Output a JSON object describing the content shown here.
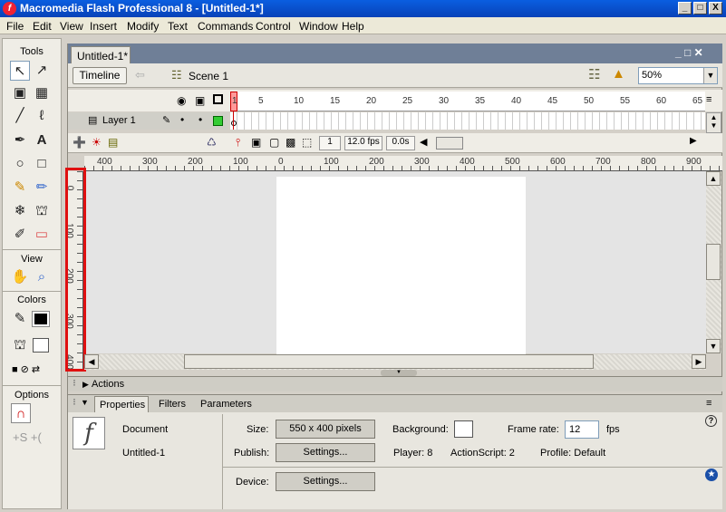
{
  "window": {
    "title": "Macromedia Flash Professional 8 - [Untitled-1*]",
    "logo": "f",
    "controls": [
      "_",
      "□",
      "X"
    ]
  },
  "menubar": {
    "items": [
      "File",
      "Edit",
      "View",
      "Insert",
      "Modify",
      "Text",
      "Commands",
      "Control",
      "Window",
      "Help"
    ]
  },
  "tools_panel": {
    "title": "Tools",
    "view_label": "View",
    "colors_label": "Colors",
    "options_label": "Options",
    "icons": [
      "arrow-icon",
      "subselect-icon",
      "free-transform-icon",
      "gradient-transform-icon",
      "line-icon",
      "lasso-icon",
      "pen-icon",
      "text-icon",
      "oval-icon",
      "rectangle-icon",
      "pencil-icon",
      "brush-icon",
      "ink-bottle-icon",
      "paint-bucket-icon",
      "eyedropper-icon",
      "eraser-icon",
      "hand-icon",
      "zoom-icon",
      "stroke-color-icon",
      "fill-color-icon",
      "snap-magnet-icon"
    ]
  },
  "document": {
    "tab_label": "Untitled-1*",
    "timeline_button": "Timeline",
    "scene_label": "Scene 1",
    "zoom_value": "50%"
  },
  "timeline": {
    "layer_name": "Layer 1",
    "frame_ticks": [
      "1",
      "5",
      "10",
      "15",
      "20",
      "25",
      "30",
      "35",
      "40",
      "45",
      "50",
      "55",
      "60",
      "65"
    ],
    "current_frame": "1",
    "fps": "12.0 fps",
    "elapsed": "0.0s"
  },
  "rulers": {
    "horizontal_ticks": [
      "400",
      "300",
      "200",
      "100",
      "0",
      "100",
      "200",
      "300",
      "400",
      "500",
      "600",
      "700",
      "800",
      "900"
    ],
    "vertical_ticks": [
      "0",
      "100",
      "200",
      "300",
      "400"
    ]
  },
  "panels": {
    "actions_label": "Actions",
    "tabs": [
      "Properties",
      "Filters",
      "Parameters"
    ]
  },
  "properties": {
    "doc_type": "Document",
    "doc_name": "Untitled-1",
    "size_label": "Size:",
    "size_value": "550 x 400 pixels",
    "publish_label": "Publish:",
    "settings_button": "Settings...",
    "device_label": "Device:",
    "device_settings_button": "Settings...",
    "background_label": "Background:",
    "framerate_label": "Frame rate:",
    "framerate_value": "12",
    "fps_unit": "fps",
    "player": "Player: 8",
    "actionscript": "ActionScript:  2",
    "profile": "Profile:  Default",
    "help_glyph": "?"
  },
  "colors": {
    "titlebar": "#0a5ee0",
    "highlight_box": "#e01010",
    "stage": "#ffffff"
  }
}
